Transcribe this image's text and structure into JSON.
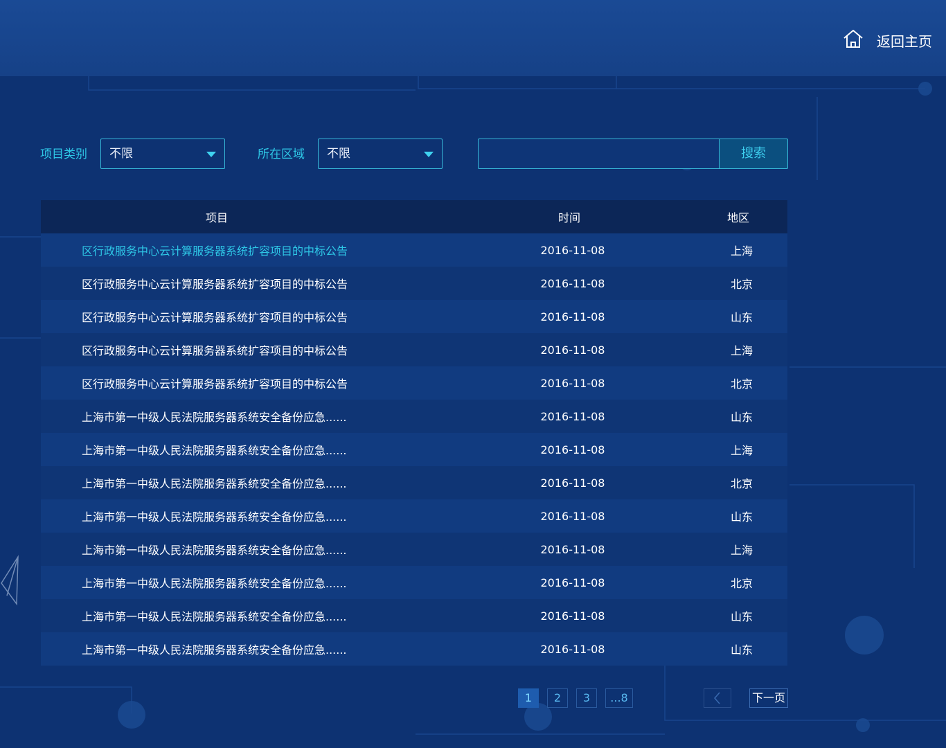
{
  "header": {
    "home_label": "返回主页",
    "home_icon": "home-icon"
  },
  "filters": {
    "category_label": "项目类别",
    "category_value": "不限",
    "region_label": "所在区域",
    "region_value": "不限",
    "search_placeholder": "",
    "search_button": "搜索"
  },
  "table": {
    "headers": {
      "project": "项目",
      "time": "时间",
      "area": "地区"
    },
    "rows": [
      {
        "project": "区行政服务中心云计算服务器系统扩容项目的中标公告",
        "time": "2016-11-08",
        "area": "上海"
      },
      {
        "project": "区行政服务中心云计算服务器系统扩容项目的中标公告",
        "time": "2016-11-08",
        "area": "北京"
      },
      {
        "project": "区行政服务中心云计算服务器系统扩容项目的中标公告",
        "time": "2016-11-08",
        "area": "山东"
      },
      {
        "project": "区行政服务中心云计算服务器系统扩容项目的中标公告",
        "time": "2016-11-08",
        "area": "上海"
      },
      {
        "project": "区行政服务中心云计算服务器系统扩容项目的中标公告",
        "time": "2016-11-08",
        "area": "北京"
      },
      {
        "project": "上海市第一中级人民法院服务器系统安全备份应急......",
        "time": "2016-11-08",
        "area": "山东"
      },
      {
        "project": "上海市第一中级人民法院服务器系统安全备份应急......",
        "time": "2016-11-08",
        "area": "上海"
      },
      {
        "project": "上海市第一中级人民法院服务器系统安全备份应急......",
        "time": "2016-11-08",
        "area": "北京"
      },
      {
        "project": "上海市第一中级人民法院服务器系统安全备份应急......",
        "time": "2016-11-08",
        "area": "山东"
      },
      {
        "project": "上海市第一中级人民法院服务器系统安全备份应急......",
        "time": "2016-11-08",
        "area": "上海"
      },
      {
        "project": "上海市第一中级人民法院服务器系统安全备份应急......",
        "time": "2016-11-08",
        "area": "北京"
      },
      {
        "project": "上海市第一中级人民法院服务器系统安全备份应急......",
        "time": "2016-11-08",
        "area": "山东"
      },
      {
        "project": "上海市第一中级人民法院服务器系统安全备份应急......",
        "time": "2016-11-08",
        "area": "山东"
      }
    ]
  },
  "pagination": {
    "pages": [
      "1",
      "2",
      "3",
      "...8"
    ],
    "current": "1",
    "prev_icon": "chevron-left-icon",
    "next_label": "下一页"
  },
  "colors": {
    "background": "#0d3272",
    "header": "#164187",
    "accent": "#2ec7e6",
    "table_head": "#0c2657"
  }
}
